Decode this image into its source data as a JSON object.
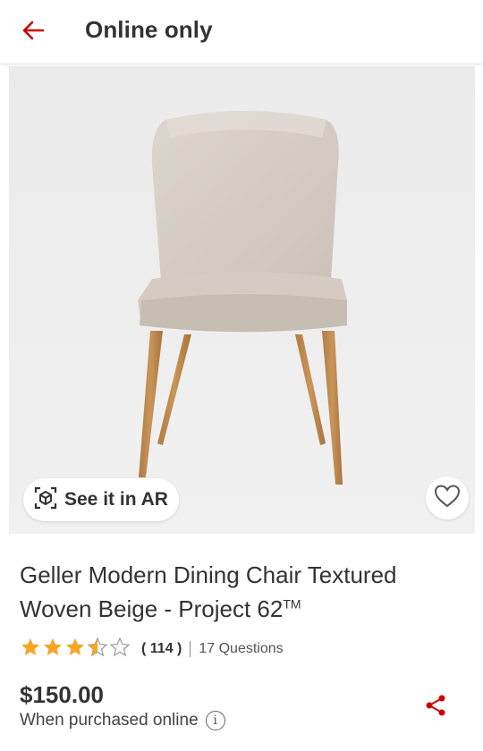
{
  "header": {
    "title": "Online only",
    "back_icon": "arrow-left-icon",
    "accent_color": "#cc0000"
  },
  "hero": {
    "image_subject": "beige upholstered dining chair with wooden legs",
    "ar_label": "See it in AR",
    "ar_icon": "ar-cube-icon",
    "favorite_icon": "heart-outline-icon"
  },
  "product": {
    "title": "Geller Modern Dining Chair Textured Woven Beige - Project 62",
    "trademark": "TM",
    "rating": 3.5,
    "rating_max": 5,
    "review_count": "( 114 )",
    "questions": "17 Questions",
    "price": "$150.00",
    "purchase_note": "When purchased online",
    "info_icon": "info-icon",
    "share_icon": "share-icon",
    "star_color": "#f5a623"
  }
}
